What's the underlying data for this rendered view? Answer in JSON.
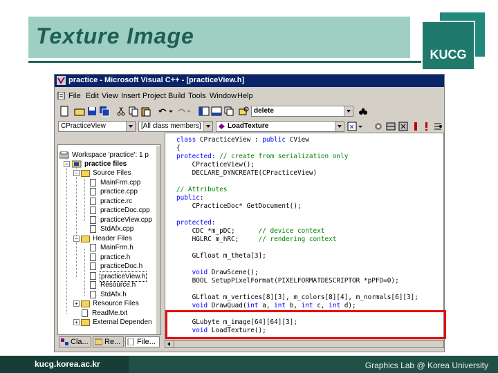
{
  "slide": {
    "title": "Texture Image",
    "badge": "KUCG",
    "footer_left": "kucg.korea.ac.kr",
    "footer_right": "Graphics Lab @ Korea University"
  },
  "window": {
    "title": "practice - Microsoft Visual C++ - [practiceView.h]",
    "menu": [
      "File",
      "Edit",
      "View",
      "Insert",
      "Project",
      "Build",
      "Tools",
      "Window",
      "Help"
    ],
    "find_combo": "delete",
    "class_combo": "CPracticeView",
    "filter_combo": "[All class members]",
    "member_combo": "LoadTexture"
  },
  "workspace": {
    "rows": [
      {
        "label": "Workspace 'practice': 1 p",
        "kind": "workspace"
      },
      {
        "label": "practice files",
        "kind": "project"
      },
      {
        "label": "Source Files",
        "kind": "folder"
      },
      {
        "label": "MainFrm.cpp",
        "kind": "file"
      },
      {
        "label": "practice.cpp",
        "kind": "file"
      },
      {
        "label": "practice.rc",
        "kind": "file"
      },
      {
        "label": "practiceDoc.cpp",
        "kind": "file"
      },
      {
        "label": "practiceView.cpp",
        "kind": "file"
      },
      {
        "label": "StdAfx.cpp",
        "kind": "file"
      },
      {
        "label": "Header Files",
        "kind": "folder"
      },
      {
        "label": "MainFrm.h",
        "kind": "file"
      },
      {
        "label": "practice.h",
        "kind": "file"
      },
      {
        "label": "practiceDoc.h",
        "kind": "file"
      },
      {
        "label": "practiceView.h",
        "kind": "file"
      },
      {
        "label": "Resource.h",
        "kind": "file"
      },
      {
        "label": "StdAfx.h",
        "kind": "file"
      },
      {
        "label": "Resource Files",
        "kind": "folder"
      },
      {
        "label": "ReadMe.txt",
        "kind": "file"
      },
      {
        "label": "External Dependen",
        "kind": "folder"
      }
    ],
    "tabs": [
      "Cla...",
      "Re...",
      "File..."
    ]
  },
  "code": [
    "class CPracticeView : public CView",
    "{",
    "protected: // create from serialization only",
    "    CPracticeView();",
    "    DECLARE_DYNCREATE(CPracticeView)",
    "",
    "// Attributes",
    "public:",
    "    CPracticeDoc* GetDocument();",
    "",
    "protected:",
    "    CDC *m_pDC;      // device context",
    "    HGLRC m_hRC;     // rendering context",
    "",
    "    GLfloat m_theta[3];",
    "",
    "    void DrawScene();",
    "    BOOL SetupPixelFormat(PIXELFORMATDESCRIPTOR *pPFD=0);",
    "",
    "    GLfloat m_vertices[8][3], m_colors[8][4], m_normals[6][3];",
    "    void DrawQuad(int a, int b, int c, int d);",
    "",
    "    GLubyte m_image[64][64][3];",
    "    void LoadTexture();"
  ]
}
